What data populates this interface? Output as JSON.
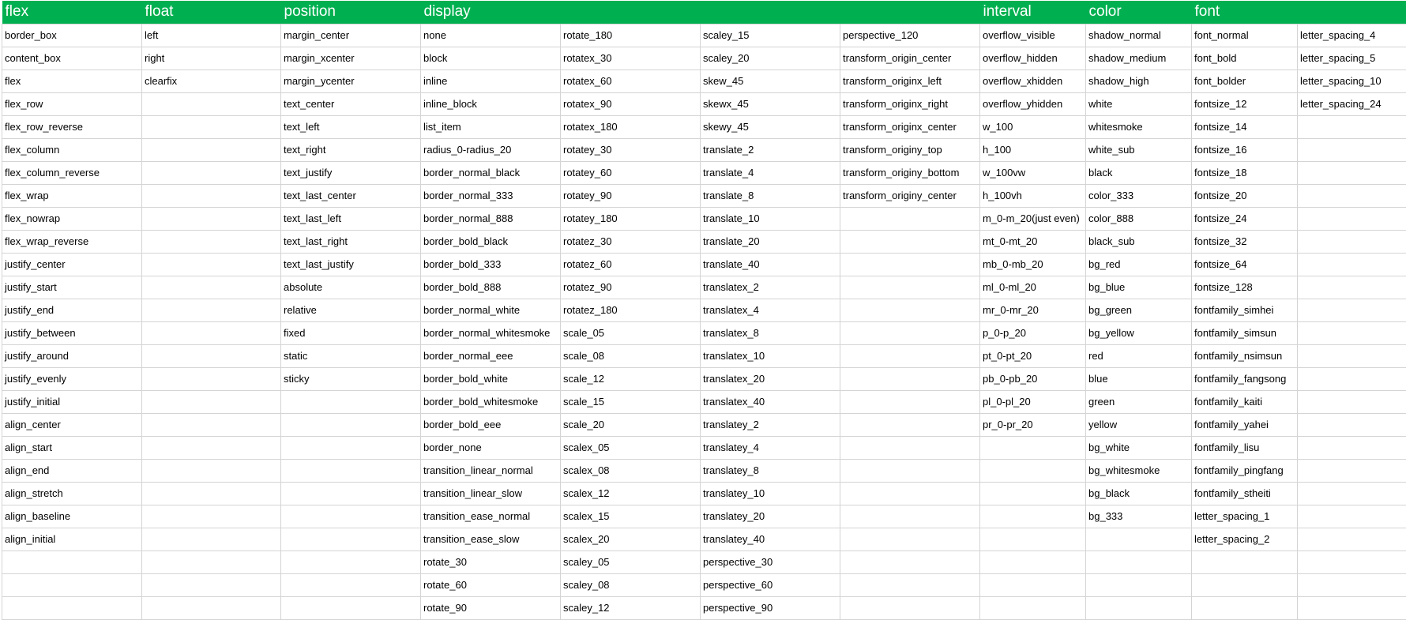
{
  "header": [
    "flex",
    "float",
    "position",
    "display",
    "",
    "",
    "",
    "interval",
    "color",
    "font",
    ""
  ],
  "rows": [
    [
      "border_box",
      "left",
      "margin_center",
      "none",
      "rotate_180",
      "scaley_15",
      "perspective_120",
      "overflow_visible",
      "shadow_normal",
      "font_normal",
      "letter_spacing_4"
    ],
    [
      "content_box",
      "right",
      "margin_xcenter",
      "block",
      "rotatex_30",
      "scaley_20",
      "transform_origin_center",
      "overflow_hidden",
      "shadow_medium",
      "font_bold",
      "letter_spacing_5"
    ],
    [
      "flex",
      "clearfix",
      "margin_ycenter",
      "inline",
      "rotatex_60",
      "skew_45",
      "transform_originx_left",
      "overflow_xhidden",
      "shadow_high",
      "font_bolder",
      "letter_spacing_10"
    ],
    [
      "flex_row",
      "",
      "text_center",
      "inline_block",
      "rotatex_90",
      "skewx_45",
      "transform_originx_right",
      "overflow_yhidden",
      "white",
      "fontsize_12",
      "letter_spacing_24"
    ],
    [
      "flex_row_reverse",
      "",
      "text_left",
      "list_item",
      "rotatex_180",
      "skewy_45",
      "transform_originx_center",
      "w_100",
      "whitesmoke",
      "fontsize_14",
      ""
    ],
    [
      "flex_column",
      "",
      "text_right",
      "radius_0-radius_20",
      "rotatey_30",
      "translate_2",
      "transform_originy_top",
      "h_100",
      "white_sub",
      "fontsize_16",
      ""
    ],
    [
      "flex_column_reverse",
      "",
      "text_justify",
      "border_normal_black",
      "rotatey_60",
      "translate_4",
      "transform_originy_bottom",
      "w_100vw",
      "black",
      "fontsize_18",
      ""
    ],
    [
      "flex_wrap",
      "",
      "text_last_center",
      "border_normal_333",
      "rotatey_90",
      "translate_8",
      "transform_originy_center",
      "h_100vh",
      "color_333",
      "fontsize_20",
      ""
    ],
    [
      "flex_nowrap",
      "",
      "text_last_left",
      "border_normal_888",
      "rotatey_180",
      "translate_10",
      "",
      "m_0-m_20(just even)",
      "color_888",
      "fontsize_24",
      ""
    ],
    [
      "flex_wrap_reverse",
      "",
      "text_last_right",
      "border_bold_black",
      "rotatez_30",
      "translate_20",
      "",
      "mt_0-mt_20",
      "black_sub",
      "fontsize_32",
      ""
    ],
    [
      "justify_center",
      "",
      "text_last_justify",
      "border_bold_333",
      "rotatez_60",
      "translate_40",
      "",
      "mb_0-mb_20",
      "bg_red",
      "fontsize_64",
      ""
    ],
    [
      "justify_start",
      "",
      "absolute",
      "border_bold_888",
      "rotatez_90",
      "translatex_2",
      "",
      "ml_0-ml_20",
      "bg_blue",
      "fontsize_128",
      ""
    ],
    [
      "justify_end",
      "",
      "relative",
      "border_normal_white",
      "rotatez_180",
      "translatex_4",
      "",
      "mr_0-mr_20",
      "bg_green",
      "fontfamily_simhei",
      ""
    ],
    [
      "justify_between",
      "",
      "fixed",
      "border_normal_whitesmoke",
      "scale_05",
      "translatex_8",
      "",
      "p_0-p_20",
      "bg_yellow",
      "fontfamily_simsun",
      ""
    ],
    [
      "justify_around",
      "",
      "static",
      "border_normal_eee",
      "scale_08",
      "translatex_10",
      "",
      "pt_0-pt_20",
      "red",
      "fontfamily_nsimsun",
      ""
    ],
    [
      "justify_evenly",
      "",
      "sticky",
      "border_bold_white",
      "scale_12",
      "translatex_20",
      "",
      "pb_0-pb_20",
      "blue",
      "fontfamily_fangsong",
      ""
    ],
    [
      "justify_initial",
      "",
      "",
      "border_bold_whitesmoke",
      "scale_15",
      "translatex_40",
      "",
      "pl_0-pl_20",
      "green",
      "fontfamily_kaiti",
      ""
    ],
    [
      "align_center",
      "",
      "",
      "border_bold_eee",
      "scale_20",
      "translatey_2",
      "",
      "pr_0-pr_20",
      "yellow",
      "fontfamily_yahei",
      ""
    ],
    [
      "align_start",
      "",
      "",
      "border_none",
      "scalex_05",
      "translatey_4",
      "",
      "",
      "bg_white",
      "fontfamily_lisu",
      ""
    ],
    [
      "align_end",
      "",
      "",
      "transition_linear_normal",
      "scalex_08",
      "translatey_8",
      "",
      "",
      "bg_whitesmoke",
      "fontfamily_pingfang",
      ""
    ],
    [
      "align_stretch",
      "",
      "",
      "transition_linear_slow",
      "scalex_12",
      "translatey_10",
      "",
      "",
      "bg_black",
      "fontfamily_stheiti",
      ""
    ],
    [
      "align_baseline",
      "",
      "",
      "transition_ease_normal",
      "scalex_15",
      "translatey_20",
      "",
      "",
      "bg_333",
      "letter_spacing_1",
      ""
    ],
    [
      "align_initial",
      "",
      "",
      "transition_ease_slow",
      "scalex_20",
      "translatey_40",
      "",
      "",
      "",
      "letter_spacing_2",
      ""
    ],
    [
      "",
      "",
      "",
      "rotate_30",
      "scaley_05",
      "perspective_30",
      "",
      "",
      "",
      "",
      ""
    ],
    [
      "",
      "",
      "",
      "rotate_60",
      "scaley_08",
      "perspective_60",
      "",
      "",
      "",
      "",
      ""
    ],
    [
      "",
      "",
      "",
      "rotate_90",
      "scaley_12",
      "perspective_90",
      "",
      "",
      "",
      "",
      ""
    ]
  ],
  "colors": {
    "header_bg": "#00b050",
    "header_text": "#ffffff",
    "grid_line": "#d4d4d4",
    "cell_text": "#000000"
  }
}
